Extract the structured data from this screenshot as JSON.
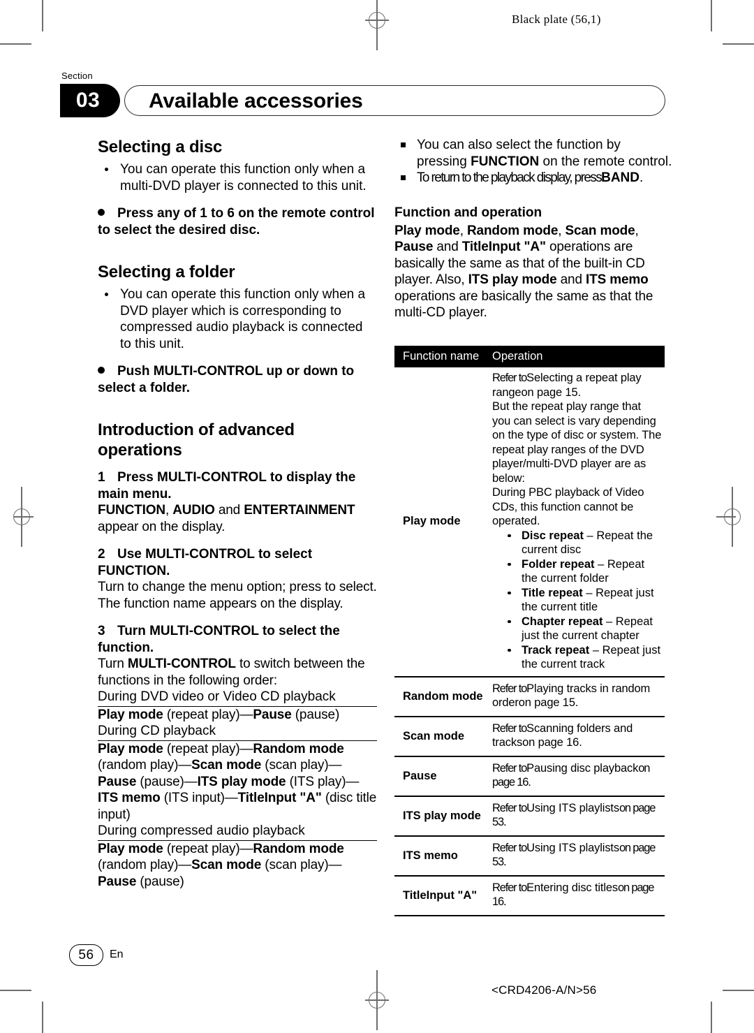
{
  "plate": "Black plate (56,1)",
  "header": {
    "section_label": "Section",
    "section_number": "03",
    "title": "Available accessories"
  },
  "left_column": {
    "heading_disc": "Selecting a disc",
    "note_disc": "You can operate this function only when a multi-DVD player is connected to this unit.",
    "action_disc_bold": "Press any of 1 to 6 on the remote control to select the desired disc.",
    "heading_folder": "Selecting a folder",
    "note_folder": "You can operate this function only when a DVD player which is corresponding to compressed audio playback is connected to this unit.",
    "action_folder_a": "Push MULTI-CONTROL",
    "action_folder_b": " up or down to select a folder.",
    "heading_intro": "Introduction of advanced operations",
    "step1_num": "1",
    "step1_bold": "Press MULTI-CONTROL to display the main menu.",
    "step1_b1": "FUNCTION",
    "step1_b2": "AUDIO",
    "step1_b3": "ENTERTAINMENT",
    "step1_tail": "appear on the display.",
    "step1_sep1": ", ",
    "step1_sep2": " and ",
    "step2_num": "2",
    "step2_bold": "Use MULTI-CONTROL to select FUNCTION.",
    "step2_body1": "Turn to change the menu option; press to select.",
    "step2_body2": "The function name appears on the display.",
    "step3_num": "3",
    "step3_bold": "Turn MULTI-CONTROL to select the function.",
    "step3_body_a": "Turn ",
    "step3_body_b": "MULTI-CONTROL",
    "step3_body_c": " to switch between the functions in the following order:",
    "order1_title": "During DVD video or Video CD playback",
    "order1_items": [
      "Play mode",
      " (repeat play)—",
      "Pause",
      " (pause)"
    ],
    "order2_title": "During CD playback",
    "order2_items": [
      "Play mode",
      " (repeat play)—",
      "Random mode",
      " (random play)—",
      "Scan mode",
      " (scan play)—",
      "Pause",
      " (pause)—",
      "ITS play mode",
      " (ITS play)—",
      "ITS memo",
      " (ITS input)—",
      "TitleInput \"A\"",
      " (disc title input)"
    ],
    "order3_title": "During compressed audio playback",
    "order3_items": [
      "Play mode",
      " (repeat play)—",
      "Random mode",
      " (random play)—",
      "Scan mode",
      " (scan play)—",
      "Pause",
      " (pause)"
    ]
  },
  "right_column": {
    "note1_a": "You can also select the function by pressing ",
    "note1_b": "FUNCTION",
    "note1_c": " on the remote control.",
    "note2_a": "To return to the playback display, press",
    "note2_b": "BAND",
    "note2_c": ".",
    "heading_funcop": "Function and operation",
    "funcop_p1": [
      "Play mode",
      ", ",
      "Random mode",
      ", ",
      "Scan mode",
      ", ",
      "Pause",
      " and ",
      "TitleInput \"A\"",
      " operations are basically the same as that of the built-in CD player. Also, ",
      "ITS play mode",
      " and ",
      "ITS memo",
      " operations are basically the same as that the multi-CD player."
    ]
  },
  "table": {
    "col1_header": "Function name",
    "col2_header": "Operation",
    "rows": [
      {
        "name": "Play mode",
        "lead1_a": "Refer to",
        "lead1_b": "Selecting a repeat play range",
        "lead1_c": "on page 15.",
        "body": "But the repeat play range that you can select is vary depending on the type of disc or system. The repeat play ranges of the DVD player/multi-DVD player are as below:",
        "body2": "During PBC playback of Video CDs, this function cannot be operated.",
        "bullets": [
          {
            "term": "Disc repeat",
            "desc": " – Repeat the current disc"
          },
          {
            "term": "Folder repeat",
            "desc": " – Repeat the current folder"
          },
          {
            "term": "Title repeat",
            "desc": " – Repeat just the current title"
          },
          {
            "term": "Chapter repeat",
            "desc": " – Repeat just the current chapter"
          },
          {
            "term": "Track repeat",
            "desc": " – Repeat just the current track"
          }
        ]
      },
      {
        "name": "Random mode",
        "lead1_a": "Refer to",
        "lead1_b": "Playing tracks in random order",
        "lead1_c": "on page 15."
      },
      {
        "name": "Scan mode",
        "lead1_a": "Refer to",
        "lead1_b": "Scanning folders and tracks",
        "lead1_c": "on page 16."
      },
      {
        "name": "Pause",
        "lead1_a": "Refer to",
        "lead1_b": "Pausing disc playback",
        "lead1_c": "on page 16."
      },
      {
        "name": "ITS play mode",
        "lead1_a": "Refer to",
        "lead1_b": "Using ITS playlists",
        "lead1_c": "on page 53."
      },
      {
        "name": "ITS memo",
        "lead1_a": "Refer to",
        "lead1_b": "Using ITS playlists",
        "lead1_c": "on page 53."
      },
      {
        "name": "TitleInput \"A\"",
        "lead1_a": "Refer to",
        "lead1_b": "Entering disc titles",
        "lead1_c": "on page 16."
      }
    ]
  },
  "footer": {
    "page_number": "56",
    "language": "En",
    "part_number": "<CRD4206-A/N>56"
  }
}
